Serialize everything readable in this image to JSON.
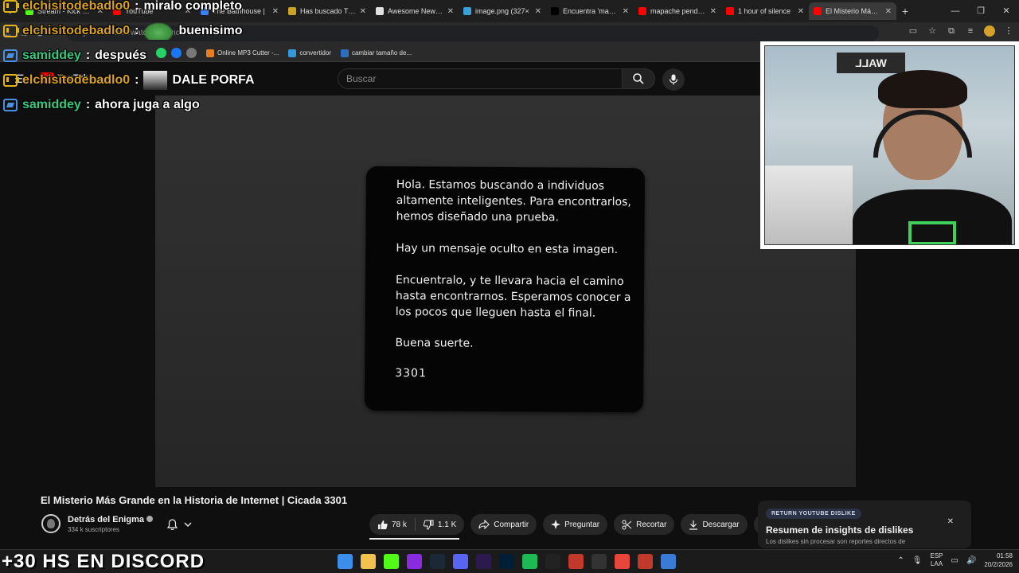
{
  "browser": {
    "tabs": [
      {
        "title": "Stream - Kick Dash",
        "color": "#53fc18"
      },
      {
        "title": "YouTube",
        "color": "#ff0000"
      },
      {
        "title": "The Bathhouse |",
        "color": "#3b82f6"
      },
      {
        "title": "Has buscado The",
        "color": "#c9a227"
      },
      {
        "title": "Awesome New Ta",
        "color": "#e0e0e0"
      },
      {
        "title": "image.png (327×",
        "color": "#3aa0d8"
      },
      {
        "title": "Encuentra 'mante",
        "color": "#000000"
      },
      {
        "title": "mapache pendejo",
        "color": "#ff0000"
      },
      {
        "title": "1 hour of silence",
        "color": "#ff0000"
      },
      {
        "title": "El Misterio Más G",
        "color": "#ff0000"
      }
    ],
    "address": "youtube.com/watch...hjh-nc",
    "bookmarks": [
      {
        "title": "Online MP3 Cutter -..."
      },
      {
        "title": "convertidor"
      },
      {
        "title": "cambiar tamaño de..."
      }
    ]
  },
  "youtube": {
    "logo": "YouTube",
    "search_placeholder": "Buscar",
    "video_title": "El Misterio Más Grande en la Historia de Internet | Cicada 3301",
    "channel": "Detrás del Enigma",
    "subscribers": "334 k suscriptores",
    "likes": "78 k",
    "dislikes": "1.1 K",
    "share": "Compartir",
    "ask": "Preguntar",
    "clip": "Recortar",
    "download": "Descargar"
  },
  "card": {
    "p1": "Hola. Estamos buscando a individuos altamente inteligentes. Para encontrarlos, hemos diseñado una prueba.",
    "p2": "Hay un mensaje oculto en esta imagen.",
    "p3": "Encuentralo, y te llevara hacia el camino hasta encontrarnos. Esperamos conocer a los pocos que lleguen hasta el final.",
    "p4": "Buena suerte.",
    "p5": "3301"
  },
  "dislike_panel": {
    "badge": "RETURN YOUTUBE DISLIKE",
    "title": "Resumen de insights de dislikes",
    "subtitle": "Los dislikes sin procesar son reportes directos de"
  },
  "chat": [
    {
      "user": "elchisitodebadlo0",
      "color": "gold",
      "text": "miralo completo",
      "emote": ""
    },
    {
      "user": "elchisitodebadlo0",
      "color": "gold",
      "text": "buenisimo",
      "emote": "frog"
    },
    {
      "user": "samiddey",
      "color": "green",
      "text": "después",
      "emote": ""
    },
    {
      "user": "elchisitodebadlo0",
      "color": "gold",
      "text": "DALE PORFA",
      "emote": "photo"
    },
    {
      "user": "samiddey",
      "color": "green",
      "text": "ahora juga a algo",
      "emote": ""
    }
  ],
  "webcam": {
    "sign": "WALL"
  },
  "overlay": {
    "discord": "+30 HS EN DISCORD"
  },
  "taskbar": {
    "lang_1": "ESP",
    "lang_2": "LAA",
    "time": "01:58",
    "date": "20/2/2026",
    "icons": [
      "#3b8eea",
      "#f2c14e",
      "#53fc18",
      "#8a2be2",
      "#1b2838",
      "#5865f2",
      "#2b1a4d",
      "#001e36",
      "#1db954",
      "#222222",
      "#c0392b",
      "#333333",
      "#e8453c",
      "#c0392b",
      "#3a7bd5"
    ]
  }
}
